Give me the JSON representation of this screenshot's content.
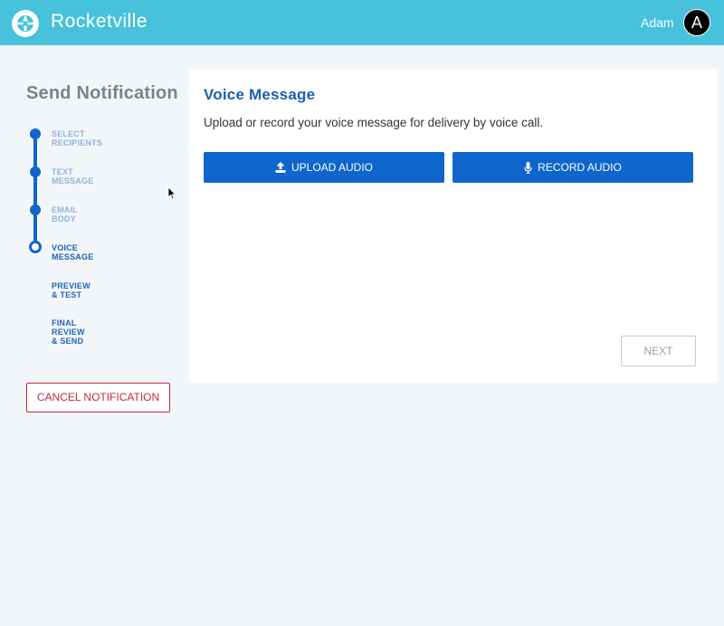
{
  "header": {
    "app_title": "Rocketville",
    "user_name": "Adam",
    "avatar_initial": "A"
  },
  "sidebar": {
    "title": "Send Notification",
    "steps": [
      {
        "label": "SELECT RECIPIENTS",
        "state": "done"
      },
      {
        "label": "TEXT MESSAGE",
        "state": "done"
      },
      {
        "label": "EMAIL BODY",
        "state": "done"
      },
      {
        "label": "VOICE MESSAGE",
        "state": "current"
      },
      {
        "label": "PREVIEW & TEST",
        "state": "todo"
      },
      {
        "label": "FINAL REVIEW & SEND",
        "state": "todo"
      }
    ],
    "cancel_label": "CANCEL NOTIFICATION"
  },
  "main": {
    "title": "Voice Message",
    "description": "Upload or record your voice message for delivery by voice call.",
    "upload_label": "UPLOAD AUDIO",
    "record_label": "RECORD AUDIO",
    "next_label": "NEXT"
  },
  "colors": {
    "header_bg": "#47c1dc",
    "primary": "#0e66cc",
    "danger": "#c3283e"
  }
}
